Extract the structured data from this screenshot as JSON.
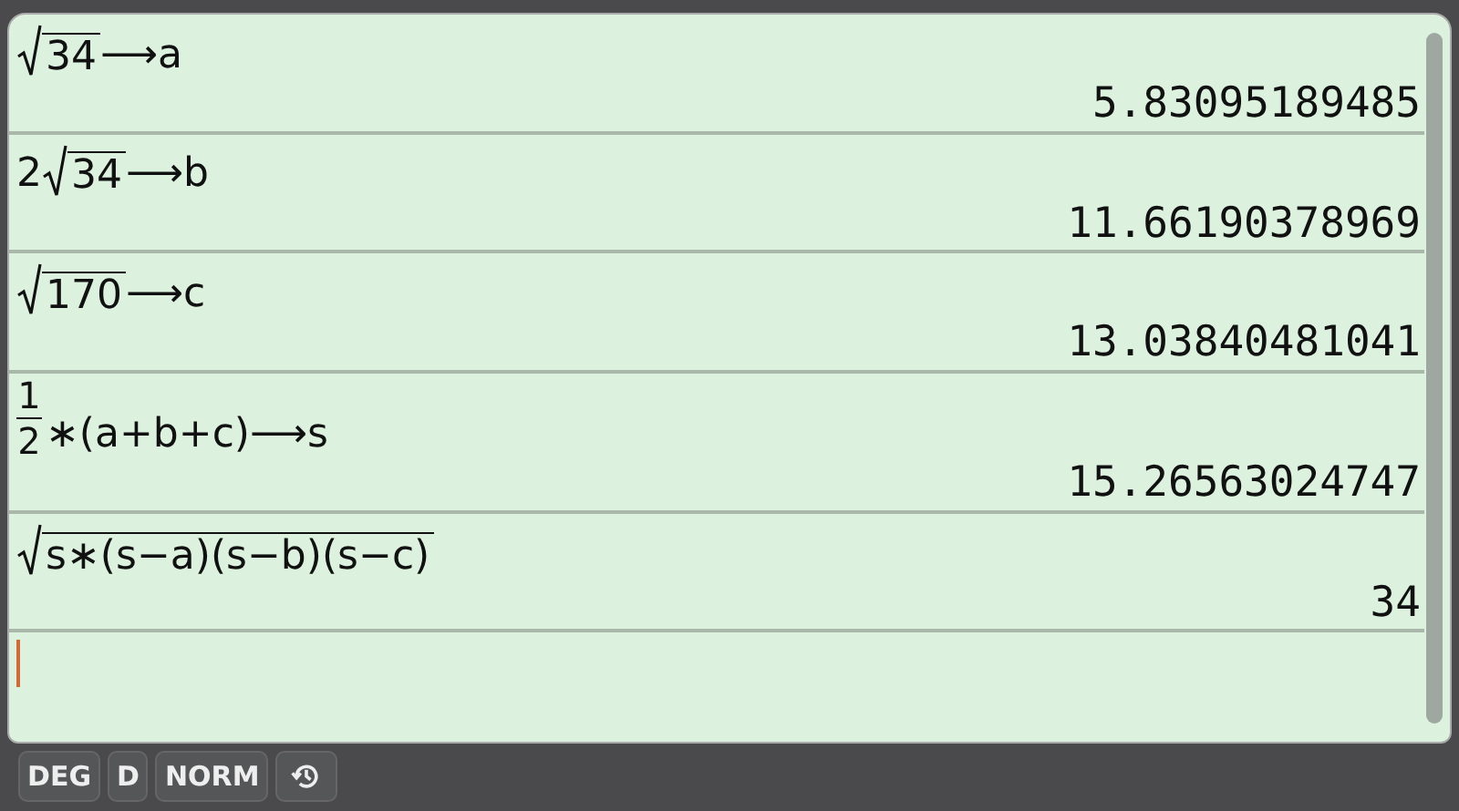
{
  "history": [
    {
      "input": [
        {
          "kind": "sqrt",
          "text": "34"
        },
        {
          "kind": "text",
          "text": "⟶a"
        }
      ],
      "result": "5.83095189485"
    },
    {
      "input": [
        {
          "kind": "text",
          "text": "2"
        },
        {
          "kind": "sqrt",
          "text": "34"
        },
        {
          "kind": "text",
          "text": "⟶b"
        }
      ],
      "result": "11.66190378969"
    },
    {
      "input": [
        {
          "kind": "sqrt",
          "text": "170"
        },
        {
          "kind": "text",
          "text": "⟶c"
        }
      ],
      "result": "13.03840481041"
    },
    {
      "input": [
        {
          "kind": "fraction",
          "numerator": "1",
          "denominator": "2"
        },
        {
          "kind": "text",
          "text": "∗(a+b+c)⟶s"
        }
      ],
      "result": "15.26563024747"
    },
    {
      "input": [
        {
          "kind": "sqrt",
          "text": "s∗(s−a)(s−b)(s−c)"
        }
      ],
      "result": "34"
    }
  ],
  "status_bar": [
    {
      "kind": "text",
      "label": "DEG"
    },
    {
      "kind": "text",
      "label": "D"
    },
    {
      "kind": "text",
      "label": "NORM"
    },
    {
      "kind": "history"
    }
  ]
}
